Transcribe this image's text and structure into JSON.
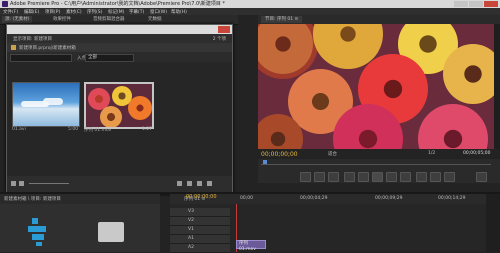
{
  "window": {
    "title": "Adobe Premiere Pro - C:\\用户\\Administrator\\我的文档\\Adobe\\Premiere Pro\\7.0\\新建项目 *"
  },
  "menu": [
    "文件(F)",
    "编辑(E)",
    "项目(P)",
    "素材(C)",
    "序列(S)",
    "标记(M)",
    "字幕(T)",
    "窗口(W)",
    "帮助(H)"
  ],
  "top_strip": {
    "tab1": "源: (无素材)",
    "tab2": "效果控件",
    "tab3": "音频剪辑混合器",
    "tab4": "元数据"
  },
  "popup": {
    "title": "",
    "project_header": "显示项目: 新建项目",
    "item_count": "2 个项",
    "project_path": "新建项目.prproj\\新建素材箱",
    "in_label": "入点:",
    "in_value": "全部",
    "thumbnails": [
      {
        "name": "01.avi",
        "duration": "5:00"
      },
      {
        "name": "序列 01.mov",
        "duration": "1:27"
      }
    ]
  },
  "monitor": {
    "tab": "节目: 序列 01 ≡",
    "timecode_left": "00;00;00;00",
    "fit": "适合",
    "fraction": "1/2",
    "timecode_right": "00;00;05;00"
  },
  "media": {
    "tab": "新建素材箱 \\ 项目: 新建项目"
  },
  "timeline": {
    "tab": "序列 01 ≡",
    "timecode": "00;00;00;00",
    "ruler_labels": [
      "00;00",
      "00;00;04;29",
      "00;00;09;29",
      "00;00;14;29"
    ],
    "tracks": [
      "V3",
      "V2",
      "V1",
      "A1",
      "A2"
    ],
    "clip_label": "序列 01.mov"
  },
  "colors": {
    "accent_timecode": "#e8b93a",
    "panel_bg": "#2a2a2a",
    "clip": "#6b5a9a"
  }
}
